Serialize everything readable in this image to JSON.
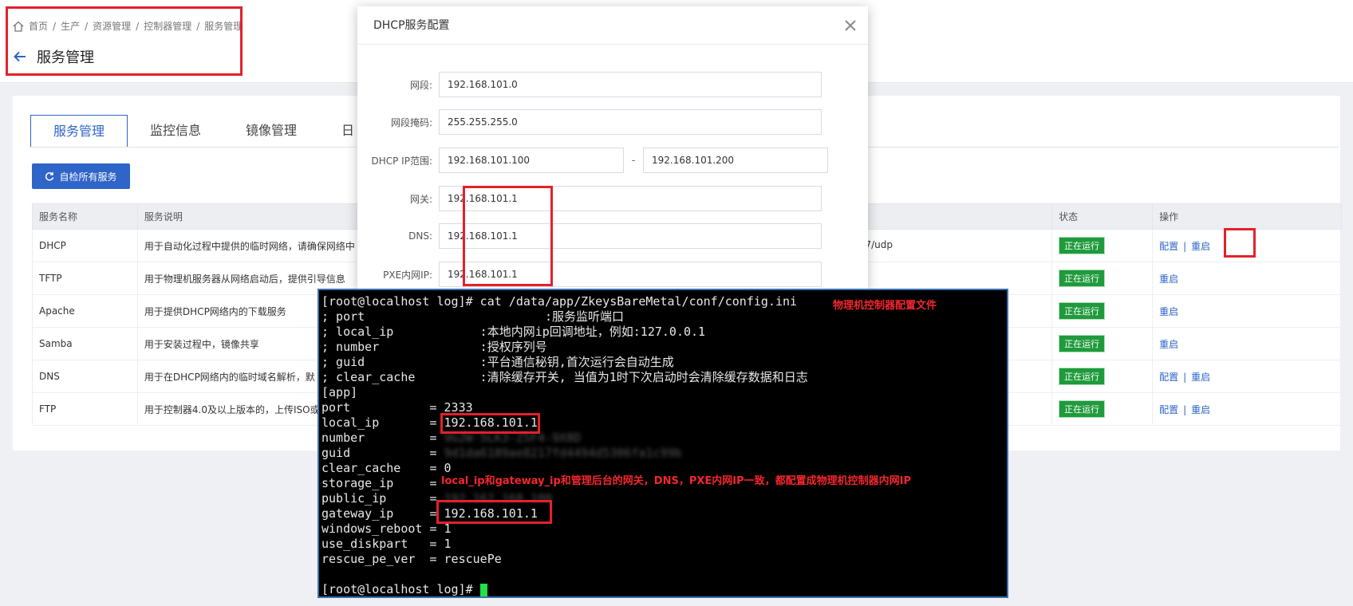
{
  "breadcrumb": {
    "items": [
      "首页",
      "生产",
      "资源管理",
      "控制器管理",
      "服务管理"
    ],
    "sep": "/"
  },
  "page_title": "服务管理",
  "tabs": [
    "服务管理",
    "监控信息",
    "镜像管理",
    "日"
  ],
  "self_check_button": "自检所有服务",
  "table": {
    "headers": {
      "name": "服务名称",
      "desc": "服务说明",
      "status": "状态",
      "ops": "操作"
    },
    "rows": [
      {
        "name": "DHCP",
        "desc": "用于自动化过程中提供的临时网络，请确保网络中",
        "port": "7/udp",
        "status": "正在运行",
        "config": "配置",
        "restart": "重启"
      },
      {
        "name": "TFTP",
        "desc": "用于物理机服务器从网络启动后，提供引导信息",
        "status": "正在运行",
        "restart": "重启"
      },
      {
        "name": "Apache",
        "desc": "用于提供DHCP网络内的下载服务",
        "status": "正在运行",
        "restart": "重启"
      },
      {
        "name": "Samba",
        "desc": "用于安装过程中，镜像共享",
        "status": "正在运行",
        "restart": "重启"
      },
      {
        "name": "DNS",
        "desc": "用于在DHCP网络内的临时域名解析，默",
        "status": "正在运行",
        "config": "配置",
        "restart": "重启"
      },
      {
        "name": "FTP",
        "desc": "用于控制器4.0及以上版本的，上传ISO或",
        "status": "正在运行",
        "config": "配置",
        "restart": "重启"
      }
    ]
  },
  "modal": {
    "title": "DHCP服务配置",
    "fields": {
      "segment": {
        "label": "网段:",
        "value": "192.168.101.0"
      },
      "mask": {
        "label": "网段掩码:",
        "value": "255.255.255.0"
      },
      "range": {
        "label": "DHCP IP范围:",
        "from": "192.168.101.100",
        "to": "192.168.101.200",
        "dash": "-"
      },
      "gateway": {
        "label": "网关:",
        "value": "192.168.101.1"
      },
      "dns": {
        "label": "DNS:",
        "value": "192.168.101.1"
      },
      "pxe": {
        "label": "PXE内网IP:",
        "value": "192.168.101.1"
      }
    }
  },
  "terminal": {
    "lines": [
      {
        "pre": "[root@localhost log]# cat /data/app/ZkeysBareMetal/conf/config.ini"
      },
      {
        "pre": "; port                         :服务监听端口"
      },
      {
        "pre": "; local_ip            :本地内网ip回调地址，例如:127.0.0.1"
      },
      {
        "pre": "; number              :授权序列号"
      },
      {
        "pre": "; guid                :平台通信秘钥,首次运行会自动生成"
      },
      {
        "pre": "; clear_cache         :清除缓存开关, 当值为1时下次启动时会清除缓存数据和日志"
      },
      {
        "pre": "[app]"
      },
      {
        "pre": "port           = 2333"
      },
      {
        "pre": "local_ip       = ",
        "val": "192.168.101.1"
      },
      {
        "pre": "number         = ",
        "blur": "9G2W-5LK3-Z5F4-9X8D"
      },
      {
        "pre": "guid           = ",
        "blur": "9d1da6189ae8217fd4494d5306fa1c99b"
      },
      {
        "pre": "clear_cache    = 0"
      },
      {
        "pre": "storage_ip     ="
      },
      {
        "pre": "public_ip      = ",
        "blur": "192.162.168.100"
      },
      {
        "pre": "gateway_ip     = ",
        "val": "192.168.101.1"
      },
      {
        "pre": "windows_reboot = 1"
      },
      {
        "pre": "use_diskpart   = 1"
      },
      {
        "pre": "rescue_pe_ver  = rescuePe"
      },
      {
        "pre": ""
      },
      {
        "pre": "[root@localhost log]# ",
        "cursor": true
      }
    ],
    "annotation_config": "物理机控制器配置文件",
    "annotation_note": "local_ip和gateway_ip和管理后台的网关，DNS，PXE内网IP一致，都配置成物理机控制器内网IP"
  },
  "colors": {
    "accent": "#2f64c8",
    "running": "#1f9a3c",
    "highlight": "#e3212b",
    "terminal_bg": "#000000",
    "cursor": "#21e04a"
  }
}
